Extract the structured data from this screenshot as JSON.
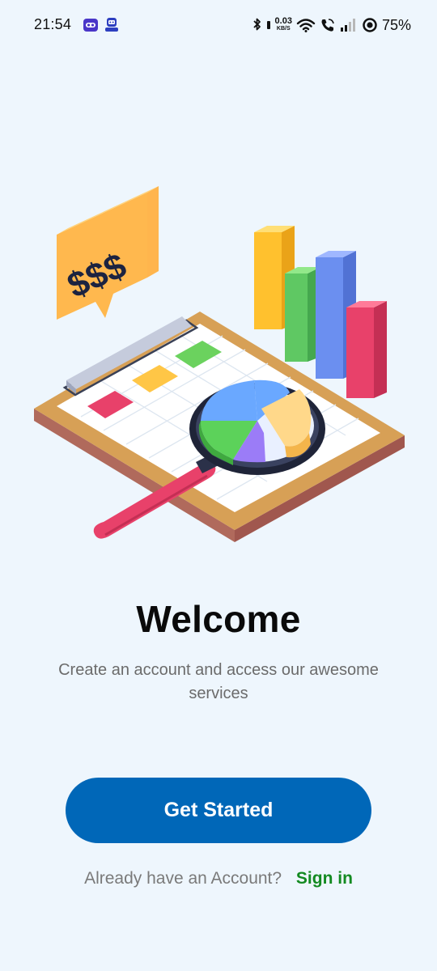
{
  "status_bar": {
    "time": "21:54",
    "net_speed_value": "0.03",
    "net_speed_unit": "KB/S",
    "battery_percent": "75%",
    "icons": [
      "bluetooth-icon",
      "wifi-icon",
      "wifi-calling-icon",
      "signal-icon",
      "battery-icon"
    ],
    "notification_icons": [
      "game-controller-icon",
      "robot-app-icon"
    ]
  },
  "illustration": {
    "price_sign_text": "$$$",
    "description_icon": "finance-analytics-illustration"
  },
  "welcome": {
    "title": "Welcome",
    "subtitle": "Create an account and access our awesome services"
  },
  "actions": {
    "get_started_label": "Get Started",
    "signin_prompt": "Already have an Account?",
    "signin_link": "Sign in"
  },
  "colors": {
    "background": "#eef6fd",
    "primary_button": "#0067b8",
    "signin_link": "#138a21",
    "subtitle_text": "#6b6b6b"
  }
}
